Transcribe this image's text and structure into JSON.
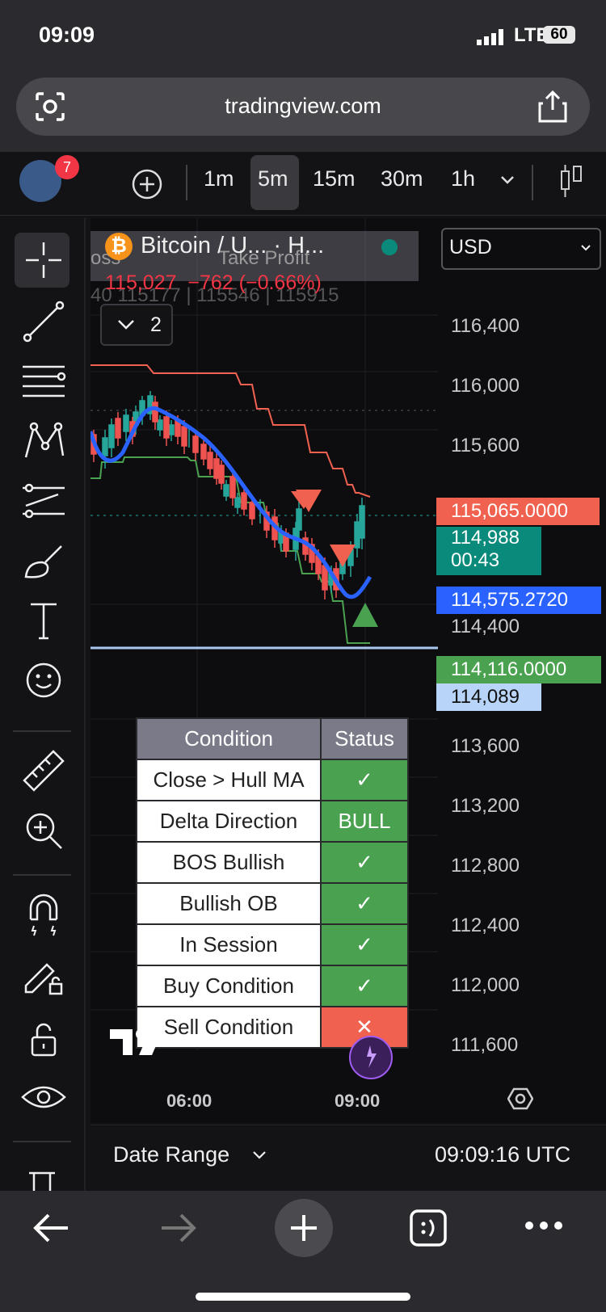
{
  "status": {
    "time": "09:09",
    "network": "LTE",
    "battery": "60"
  },
  "browser": {
    "url": "tradingview.com"
  },
  "toolbar": {
    "notif_count": "7",
    "timeframes": [
      "1m",
      "5m",
      "15m",
      "30m",
      "1h"
    ],
    "active_timeframe": "5m"
  },
  "chart": {
    "symbol_title": "Bitcoin / U... · H...",
    "overlay_labels": [
      "oss",
      "Take Profit"
    ],
    "ghost_values": "40  115177 | 115546 | 115915",
    "price_change": "115,027  −762 (−0.66%)",
    "indicators_count": "2",
    "currency": "USD",
    "price_axis": [
      "116,400",
      "116,000",
      "115,600",
      "114,400",
      "113,600",
      "113,200",
      "112,800",
      "112,400",
      "112,000",
      "111,600"
    ],
    "tags": {
      "red": "115,065.0000",
      "teal_price": "114,988",
      "teal_timer": "00:43",
      "blue": "114,575.2720",
      "green": "114,116.0000",
      "light": "114,089"
    },
    "time_axis": [
      "06:00",
      "09:00"
    ],
    "date_range_label": "Date Range",
    "utc_clock": "09:09:16 UTC",
    "colors": {
      "up": "#26a69a",
      "down": "#ef5350",
      "hull": "#2962ff",
      "stop": "#f0614f",
      "support": "#4aa14f"
    }
  },
  "table": {
    "headers": [
      "Condition",
      "Status"
    ],
    "rows": [
      {
        "condition": "Close > Hull MA",
        "status": "✓"
      },
      {
        "condition": "Delta Direction",
        "status": "BULL"
      },
      {
        "condition": "BOS Bullish",
        "status": "✓"
      },
      {
        "condition": "Bullish OB",
        "status": "✓"
      },
      {
        "condition": "In Session",
        "status": "✓"
      },
      {
        "condition": "Buy Condition",
        "status": "✓"
      },
      {
        "condition": "Sell Condition",
        "status": "✕"
      }
    ]
  }
}
